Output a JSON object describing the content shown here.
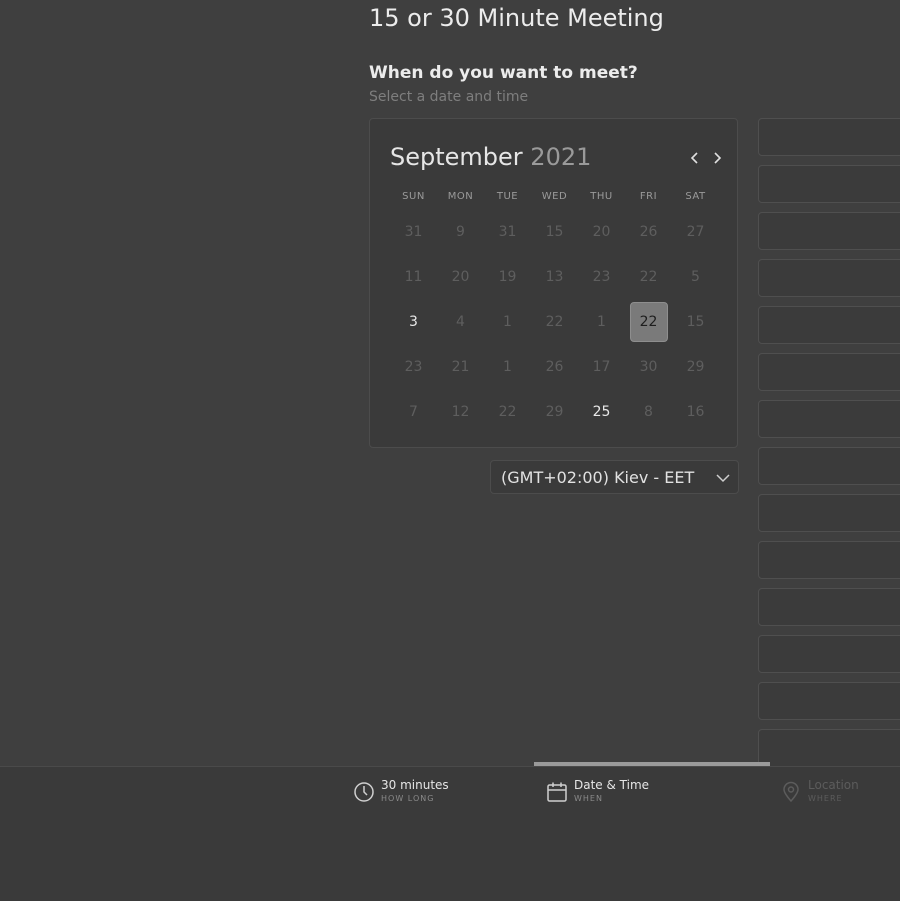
{
  "page": {
    "title": "15 or 30 Minute Meeting",
    "question": "When do you want to meet?",
    "subtitle": "Select a date and time"
  },
  "calendar": {
    "month": "September",
    "year": "2021",
    "prev_icon": "chevron-left-icon",
    "next_icon": "chevron-right-icon",
    "weekdays": [
      "SUN",
      "MON",
      "TUE",
      "WED",
      "THU",
      "FRI",
      "SAT"
    ],
    "weeks": [
      [
        "31",
        "9",
        "31",
        "15",
        "20",
        "26",
        "27"
      ],
      [
        "11",
        "20",
        "19",
        "13",
        "23",
        "22",
        "5"
      ],
      [
        "3",
        "4",
        "1",
        "22",
        "1",
        "22",
        "15"
      ],
      [
        "23",
        "21",
        "1",
        "26",
        "17",
        "30",
        "29"
      ],
      [
        "7",
        "12",
        "22",
        "29",
        "25",
        "8",
        "16"
      ]
    ],
    "available": [
      [
        2,
        0
      ],
      [
        4,
        4
      ]
    ],
    "selected": [
      2,
      5
    ]
  },
  "timezone": {
    "label": "(GMT+02:00) Kiev - EET",
    "icon": "chevron-down-icon"
  },
  "time_slots": {
    "count": 14
  },
  "steps": [
    {
      "label": "30 minutes",
      "caption": "HOW LONG",
      "icon": "clock-icon",
      "state": "done"
    },
    {
      "label": "Date & Time",
      "caption": "WHEN",
      "icon": "calendar-icon",
      "state": "active"
    },
    {
      "label": "Location",
      "caption": "WHERE",
      "icon": "location-pin-icon",
      "state": "upcoming"
    }
  ],
  "colors": {
    "background": "#3f3f3f",
    "selected_day": "#7a7a7a",
    "progress": "#9a9a9a"
  }
}
